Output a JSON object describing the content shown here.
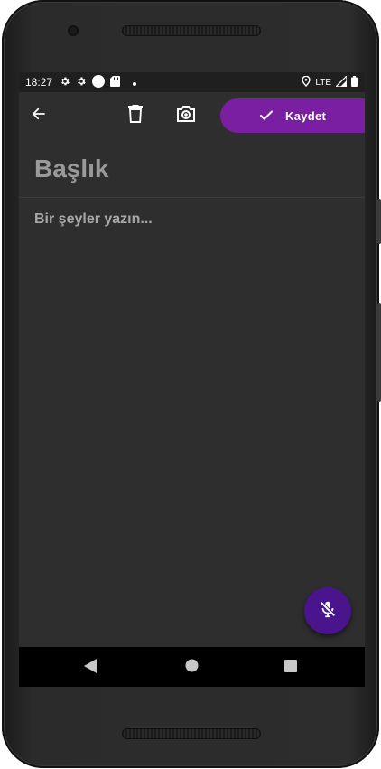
{
  "status_bar": {
    "time": "18:27",
    "network": "LTE",
    "left_icons": [
      "gear-icon",
      "gear-icon",
      "circle-icon",
      "sd-card-icon",
      "dot-icon"
    ],
    "right_icons": [
      "location-icon",
      "signal-icon",
      "battery-icon"
    ]
  },
  "toolbar": {
    "back_icon": "arrow-left-icon",
    "delete_icon": "trash-icon",
    "camera_icon": "camera-icon",
    "save_label": "Kaydet",
    "save_icon": "check-icon",
    "accent": "#7b1fa2"
  },
  "editor": {
    "title_placeholder": "Başlık",
    "body_placeholder": "Bir şeyler yazın..."
  },
  "fab": {
    "icon": "mic-off-icon",
    "color": "#4a148c"
  },
  "nav": {
    "back_icon": "nav-back-icon",
    "home_icon": "nav-home-icon",
    "recents_icon": "nav-recents-icon"
  }
}
